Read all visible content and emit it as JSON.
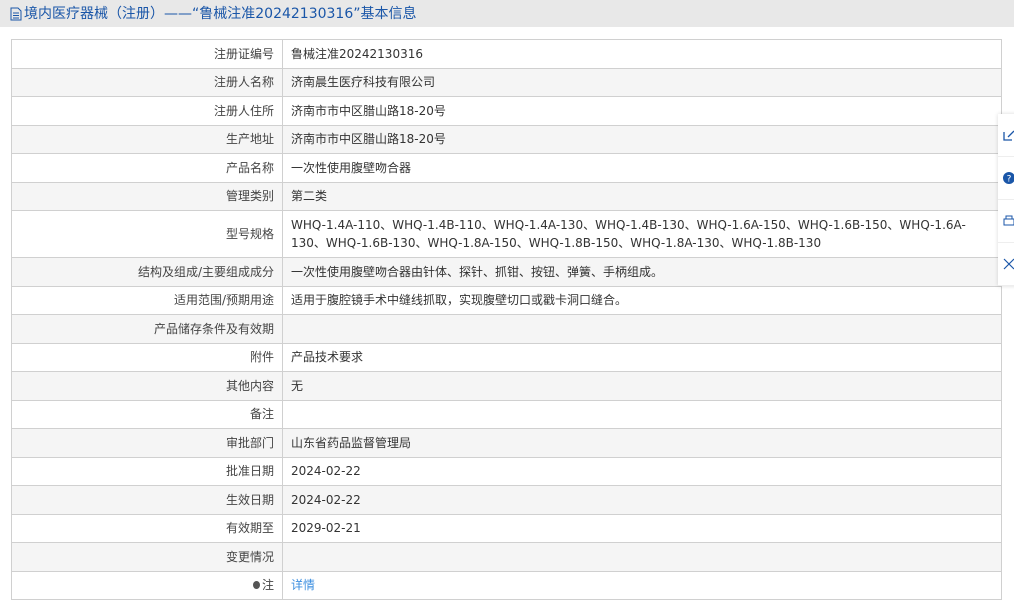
{
  "header": {
    "title": "境内医疗器械（注册）——“鲁械注准20242130316”基本信息"
  },
  "rows": [
    {
      "label": "注册证编号",
      "value": "鲁械注准20242130316"
    },
    {
      "label": "注册人名称",
      "value": "济南晨生医疗科技有限公司"
    },
    {
      "label": "注册人住所",
      "value": "济南市市中区腊山路18-20号"
    },
    {
      "label": "生产地址",
      "value": "济南市市中区腊山路18-20号"
    },
    {
      "label": "产品名称",
      "value": "一次性使用腹壁吻合器"
    },
    {
      "label": "管理类别",
      "value": "第二类"
    },
    {
      "label": "型号规格",
      "value": "WHQ-1.4A-110、WHQ-1.4B-110、WHQ-1.4A-130、WHQ-1.4B-130、WHQ-1.6A-150、WHQ-1.6B-150、WHQ-1.6A-130、WHQ-1.6B-130、WHQ-1.8A-150、WHQ-1.8B-150、WHQ-1.8A-130、WHQ-1.8B-130"
    },
    {
      "label": "结构及组成/主要组成成分",
      "value": "一次性使用腹壁吻合器由针体、探针、抓钳、按钮、弹簧、手柄组成。"
    },
    {
      "label": "适用范围/预期用途",
      "value": "适用于腹腔镜手术中缝线抓取，实现腹壁切口或戳卡洞口缝合。"
    },
    {
      "label": "产品储存条件及有效期",
      "value": ""
    },
    {
      "label": "附件",
      "value": "产品技术要求"
    },
    {
      "label": "其他内容",
      "value": "无"
    },
    {
      "label": "备注",
      "value": ""
    },
    {
      "label": "审批部门",
      "value": "山东省药品监督管理局"
    },
    {
      "label": "批准日期",
      "value": "2024-02-22"
    },
    {
      "label": "生效日期",
      "value": "2024-02-22"
    },
    {
      "label": "有效期至",
      "value": "2029-02-21"
    },
    {
      "label": "变更情况",
      "value": ""
    }
  ],
  "note": {
    "label": "注",
    "link": "详情"
  }
}
